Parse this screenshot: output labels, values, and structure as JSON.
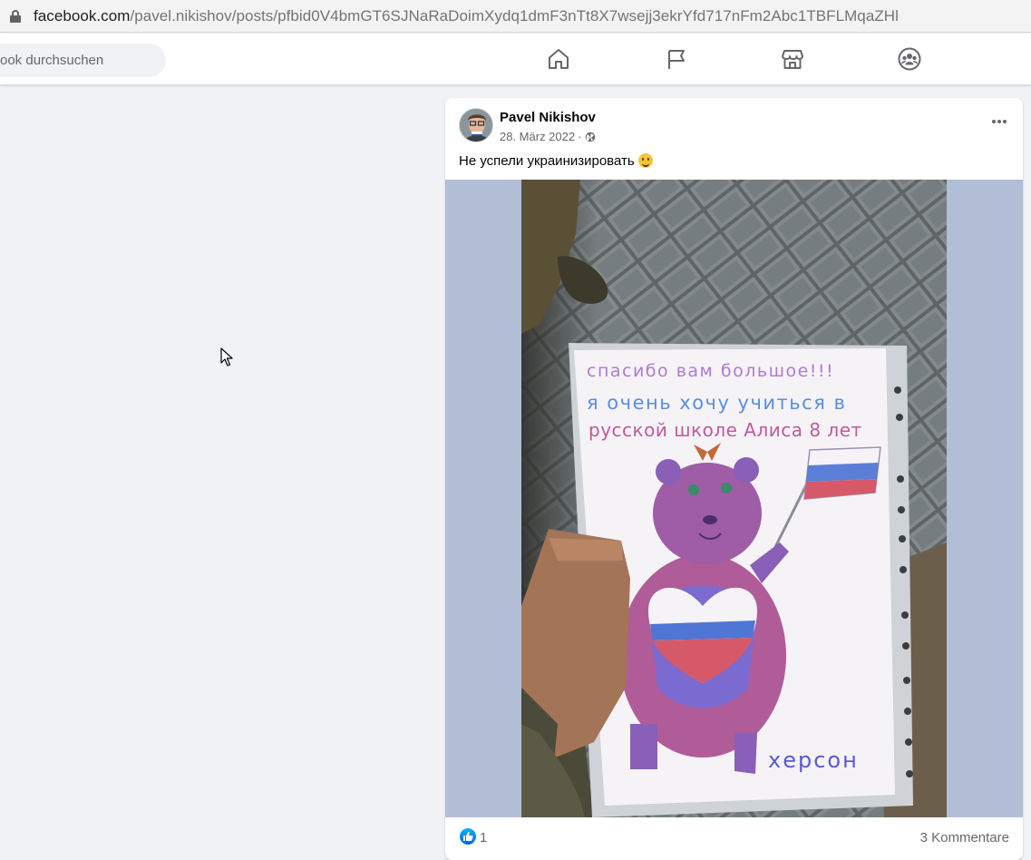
{
  "browser": {
    "url_host": "facebook.com",
    "url_path": "/pavel.nikishov/posts/pfbid0V4bmGT6SJNaRaDoimXydq1dmF3nTt8X7wsejj3ekrYfd717nFm2Abc1TBFLMqaZHl"
  },
  "header": {
    "search_placeholder": "ook durchsuchen",
    "nav_icons": [
      "home-icon",
      "pages-flag-icon",
      "marketplace-icon",
      "groups-icon"
    ]
  },
  "post": {
    "author": "Pavel Nikishov",
    "date": "28. März 2022",
    "date_separator": "·",
    "audience_icon": "globe-icon",
    "text": "Не успели украинизировать",
    "emoji": "smile-emoji",
    "image": {
      "drawing_lines": [
        "спасибо вам большое!!!",
        "я очень хочу учиться в",
        "русской школе Алиса 8 лет"
      ],
      "drawing_caption": "херсон"
    },
    "reactions": {
      "count": "1",
      "icon": "like-icon"
    },
    "comments_label": "3 Kommentare"
  },
  "colors": {
    "page_bg": "#f0f2f5",
    "media_bg": "#b2bdd6",
    "like_blue": "#0866ff"
  }
}
